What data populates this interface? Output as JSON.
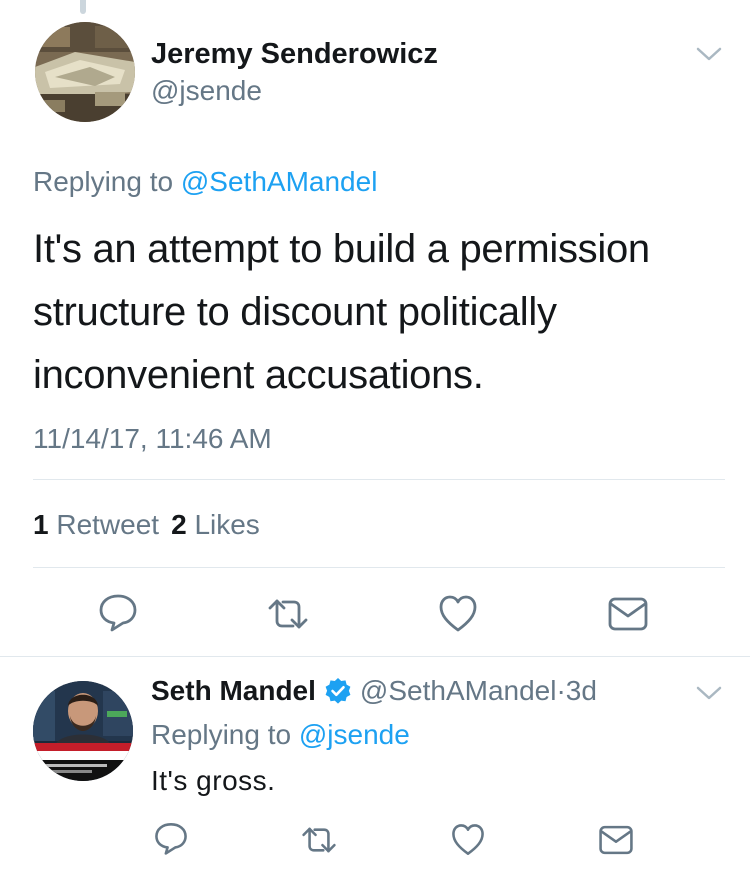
{
  "main_tweet": {
    "author_name": "Jeremy Senderowicz",
    "author_handle": "@jsende",
    "replying_prefix": "Replying to ",
    "replying_to": "@SethAMandel",
    "text": "It's an attempt to build a permission structure to discount politically inconvenient accusations.",
    "timestamp": "11/14/17, 11:46 AM",
    "retweet_count": "1",
    "retweet_label": "Retweet",
    "like_count": "2",
    "like_label": "Likes",
    "actions": [
      "reply-icon",
      "retweet-icon",
      "heart-icon",
      "envelope-icon"
    ]
  },
  "reply_tweet": {
    "author_name": "Seth Mandel",
    "verified": true,
    "author_handle": "@SethAMandel",
    "separator": " · ",
    "time_ago": "3d",
    "replying_prefix": "Replying to ",
    "replying_to": "@jsende",
    "text": "It's gross.",
    "actions": [
      "reply-icon",
      "retweet-icon",
      "heart-icon",
      "envelope-icon"
    ]
  },
  "colors": {
    "link": "#1da1f2",
    "secondary_text": "#657786",
    "primary_text": "#14171a",
    "icon": "#657786",
    "divider": "#e1e8ed"
  }
}
